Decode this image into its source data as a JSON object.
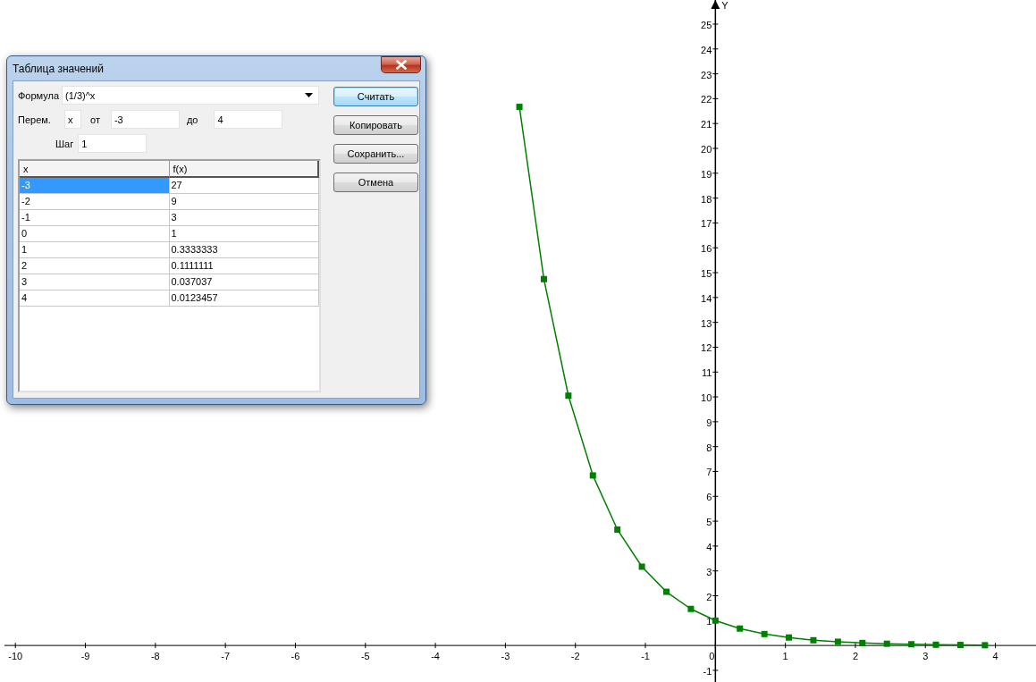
{
  "graph": {
    "chart_data": {
      "type": "line",
      "ylabel": "Y",
      "x": [
        -2.8,
        -2.45,
        -2.1,
        -1.75,
        -1.4,
        -1.05,
        -0.7,
        -0.35,
        0,
        0.35,
        0.7,
        1.05,
        1.4,
        1.75,
        2.1,
        2.45,
        2.8,
        3.15,
        3.5,
        3.85
      ],
      "series": [
        {
          "color": "#008000",
          "marker": "square",
          "values": [
            21.67,
            14.74,
            10.05,
            6.84,
            4.66,
            3.17,
            2.16,
            1.47,
            1,
            0.68,
            0.46,
            0.32,
            0.21,
            0.15,
            0.1,
            0.07,
            0.05,
            0.03,
            0.02,
            0.01
          ]
        }
      ],
      "xlim": [
        -10.22,
        4.58
      ],
      "ylim": [
        -1.47,
        25.97
      ],
      "xticks": [
        -10,
        -9,
        -8,
        -7,
        -6,
        -5,
        -4,
        -3,
        -2,
        -1,
        0,
        1,
        2,
        3,
        4
      ],
      "yticks": [
        -1,
        1,
        2,
        3,
        4,
        5,
        6,
        7,
        8,
        9,
        10,
        11,
        12,
        13,
        14,
        15,
        16,
        17,
        18,
        19,
        20,
        21,
        22,
        23,
        24,
        25
      ]
    }
  },
  "dialog": {
    "title": "Таблица значений",
    "formula": {
      "label": "Формула",
      "value": "(1/3)^x"
    },
    "variable": {
      "label": "Перем.",
      "value": "x"
    },
    "from": {
      "label": "от",
      "value": "-3"
    },
    "to": {
      "label": "до",
      "value": "4"
    },
    "step": {
      "label": "Шаг",
      "value": "1"
    },
    "table": {
      "columns": [
        "x",
        "f(x)"
      ],
      "rows": [
        {
          "cells": [
            "-3",
            "27"
          ],
          "selected": true
        },
        {
          "cells": [
            "-2",
            "9"
          ],
          "selected": false
        },
        {
          "cells": [
            "-1",
            "3"
          ],
          "selected": false
        },
        {
          "cells": [
            "0",
            "1"
          ],
          "selected": false
        },
        {
          "cells": [
            "1",
            "0.3333333"
          ],
          "selected": false
        },
        {
          "cells": [
            "2",
            "0.1111111"
          ],
          "selected": false
        },
        {
          "cells": [
            "3",
            "0.037037"
          ],
          "selected": false
        },
        {
          "cells": [
            "4",
            "0.0123457"
          ],
          "selected": false
        }
      ]
    },
    "buttons": [
      {
        "label": "Считать",
        "focused": true
      },
      {
        "label": "Копировать",
        "focused": false
      },
      {
        "label": "Сохранить...",
        "focused": false
      },
      {
        "label": "Отмена",
        "focused": false
      }
    ]
  }
}
